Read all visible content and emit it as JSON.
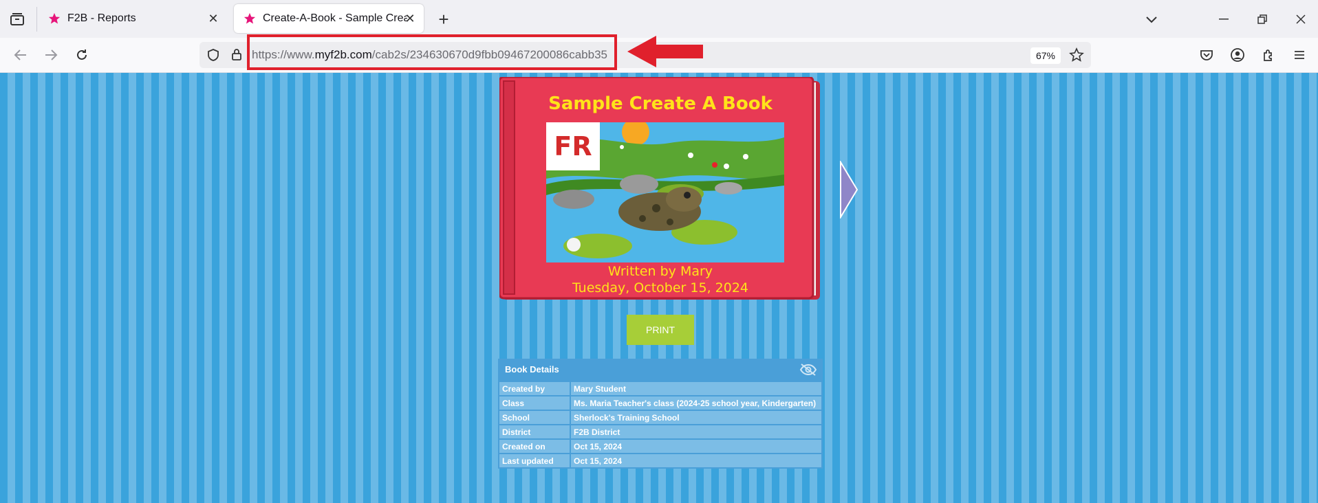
{
  "browser": {
    "tabs": [
      {
        "title": "F2B - Reports",
        "active": false
      },
      {
        "title": "Create-A-Book - Sample Create",
        "active": true
      }
    ],
    "url_prefix": "https://www.",
    "url_domain": "myf2b.com",
    "url_path": "/cab2s/234630670d9fbb09467200086cabb35",
    "zoom": "67%",
    "highlight_color": "#e0202c"
  },
  "book": {
    "title": "Sample Create A Book",
    "language_badge": "FR",
    "author_line": "Written by Mary",
    "date_line": "Tuesday, October 15, 2024",
    "cover_color": "#e83a54"
  },
  "print_label": "PRINT",
  "details": {
    "heading": "Book Details",
    "rows": [
      {
        "label": "Created by",
        "value": "Mary Student"
      },
      {
        "label": "Class",
        "value": "Ms. Maria Teacher's class (2024-25 school year, Kindergarten)"
      },
      {
        "label": "School",
        "value": "Sherlock's Training School"
      },
      {
        "label": "District",
        "value": "F2B District"
      },
      {
        "label": "Created on",
        "value": "Oct 15, 2024"
      },
      {
        "label": "Last updated",
        "value": "Oct 15, 2024"
      }
    ]
  }
}
